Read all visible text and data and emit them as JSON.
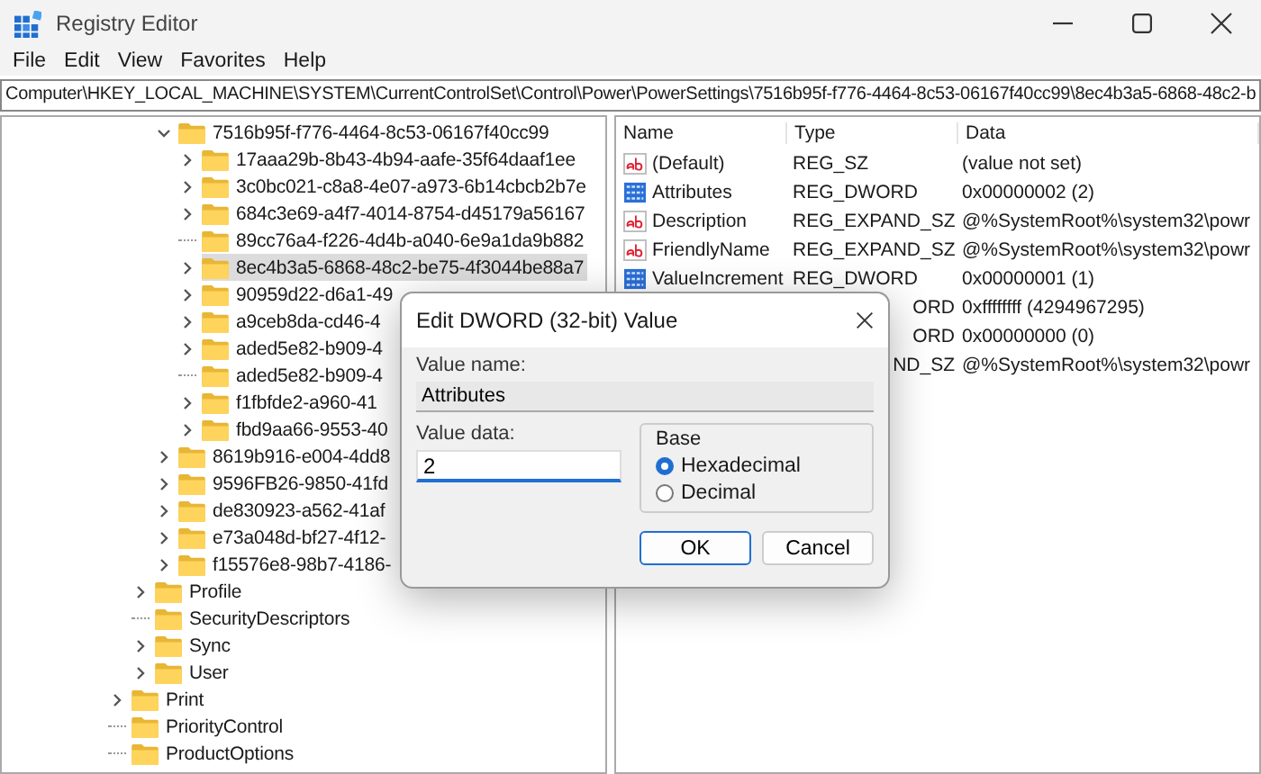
{
  "window": {
    "title": "Registry Editor"
  },
  "menu": [
    "File",
    "Edit",
    "View",
    "Favorites",
    "Help"
  ],
  "address_bar": {
    "value": "Computer\\HKEY_LOCAL_MACHINE\\SYSTEM\\CurrentControlSet\\Control\\Power\\PowerSettings\\7516b95f-f776-4464-8c53-06167f40cc99\\8ec4b3a5-6868-48c2-b"
  },
  "tree": {
    "items": [
      {
        "kind": "group",
        "children": [
          {
            "kind": "group",
            "children": [
              {
                "kind": "branch",
                "label": "7516b95f-f776-4464-8c53-06167f40cc99",
                "expanded": true,
                "selected": false,
                "children": [
                  {
                    "kind": "branch",
                    "label": "17aaa29b-8b43-4b94-aafe-35f64daaf1ee",
                    "expanded": false,
                    "selected": false
                  },
                  {
                    "kind": "branch",
                    "label": "3c0bc021-c8a8-4e07-a973-6b14cbcb2b7e",
                    "expanded": false,
                    "selected": false
                  },
                  {
                    "kind": "branch",
                    "label": "684c3e69-a4f7-4014-8754-d45179a56167",
                    "expanded": false,
                    "selected": false
                  },
                  {
                    "kind": "leaf",
                    "label": "89cc76a4-f226-4d4b-a040-6e9a1da9b882",
                    "selected": false
                  },
                  {
                    "kind": "branch",
                    "label": "8ec4b3a5-6868-48c2-be75-4f3044be88a7",
                    "expanded": false,
                    "selected": true
                  },
                  {
                    "kind": "branch",
                    "label": "90959d22-d6a1-49",
                    "expanded": false,
                    "selected": false
                  },
                  {
                    "kind": "branch",
                    "label": "a9ceb8da-cd46-4",
                    "expanded": false,
                    "selected": false
                  },
                  {
                    "kind": "branch",
                    "label": "aded5e82-b909-4",
                    "expanded": false,
                    "selected": false
                  },
                  {
                    "kind": "leaf",
                    "label": "aded5e82-b909-4",
                    "selected": false
                  },
                  {
                    "kind": "branch",
                    "label": "f1fbfde2-a960-41",
                    "expanded": false,
                    "selected": false
                  },
                  {
                    "kind": "branch",
                    "label": "fbd9aa66-9553-40",
                    "expanded": false,
                    "selected": false
                  }
                ]
              },
              {
                "kind": "branch",
                "label": "8619b916-e004-4dd8",
                "expanded": false,
                "selected": false
              },
              {
                "kind": "branch",
                "label": "9596FB26-9850-41fd",
                "expanded": false,
                "selected": false
              },
              {
                "kind": "branch",
                "label": "de830923-a562-41af",
                "expanded": false,
                "selected": false
              },
              {
                "kind": "branch",
                "label": "e73a048d-bf27-4f12-",
                "expanded": false,
                "selected": false
              },
              {
                "kind": "branch",
                "label": "f15576e8-98b7-4186-",
                "expanded": false,
                "selected": false
              }
            ]
          },
          {
            "kind": "branch",
            "label": "Profile",
            "expanded": false,
            "selected": false
          },
          {
            "kind": "leaf",
            "label": "SecurityDescriptors",
            "selected": false
          },
          {
            "kind": "branch",
            "label": "Sync",
            "expanded": false,
            "selected": false
          },
          {
            "kind": "branch",
            "label": "User",
            "expanded": false,
            "selected": false
          }
        ]
      },
      {
        "kind": "branch",
        "label": "Print",
        "expanded": false,
        "selected": false
      },
      {
        "kind": "leaf",
        "label": "PriorityControl",
        "selected": false
      },
      {
        "kind": "leaf",
        "label": "ProductOptions",
        "selected": false
      }
    ]
  },
  "values": {
    "columns": [
      "Name",
      "Type",
      "Data"
    ],
    "rows": [
      {
        "kind": "string",
        "name": "(Default)",
        "type": "REG_SZ",
        "data": "(value not set)"
      },
      {
        "kind": "number",
        "name": "Attributes",
        "type": "REG_DWORD",
        "data": "0x00000002 (2)"
      },
      {
        "kind": "string",
        "name": "Description",
        "type": "REG_EXPAND_SZ",
        "data": "@%SystemRoot%\\system32\\powr"
      },
      {
        "kind": "string",
        "name": "FriendlyName",
        "type": "REG_EXPAND_SZ",
        "data": "@%SystemRoot%\\system32\\powr"
      },
      {
        "kind": "number",
        "name": "ValueIncrement",
        "type": "REG_DWORD",
        "data": "0x00000001 (1)"
      },
      {
        "type": "ORD",
        "data": "0xffffffff (4294967295)"
      },
      {
        "type": "ORD",
        "data": "0x00000000 (0)"
      },
      {
        "type": "ND_SZ",
        "data": "@%SystemRoot%\\system32\\powr"
      }
    ]
  },
  "dialog": {
    "title": "Edit DWORD (32-bit) Value",
    "value_name_label": "Value name:",
    "value_name": "Attributes",
    "value_data_label": "Value data:",
    "value_data": "2",
    "base": {
      "label": "Base",
      "options": [
        {
          "label": "Hexadecimal",
          "selected": true
        },
        {
          "label": "Decimal",
          "selected": false
        }
      ]
    },
    "buttons": [
      "OK",
      "Cancel"
    ]
  }
}
